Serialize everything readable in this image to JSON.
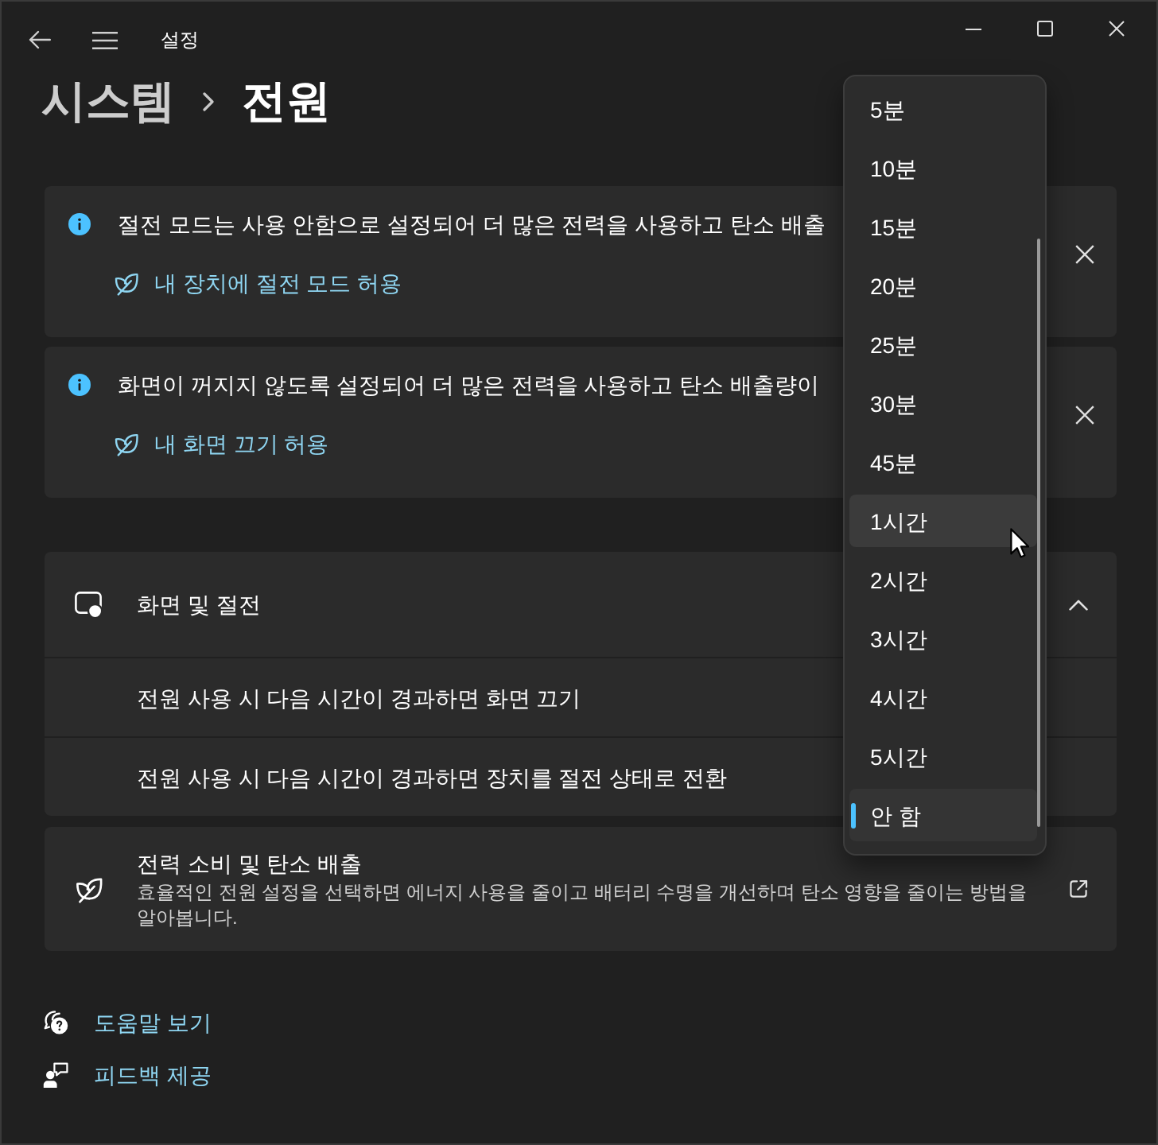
{
  "window": {
    "title": "설정"
  },
  "breadcrumb": [
    {
      "label": "시스템",
      "current": false
    },
    {
      "label": "전원",
      "current": true
    }
  ],
  "notices": [
    {
      "message": "절전 모드는 사용 안함으로 설정되어 더 많은 전력을 사용하고 탄소 배출",
      "link": "내 장치에 절전 모드 허용"
    },
    {
      "message": "화면이 꺼지지 않도록 설정되어 더 많은 전력을 사용하고 탄소 배출량이",
      "link": "내 화면 끄기 허용"
    }
  ],
  "screen_and_sleep": {
    "title": "화면 및 절전",
    "expanded": true,
    "rows": [
      {
        "label": "전원 사용 시 다음 시간이 경과하면 화면 끄기"
      },
      {
        "label": "전원 사용 시 다음 시간이 경과하면 장치를 절전 상태로 전환"
      }
    ]
  },
  "power_card": {
    "title": "전력 소비 및 탄소 배출",
    "description": "효율적인 전원 설정을 선택하면 에너지 사용을 줄이고 배터리 수명을 개선하며 탄소 영향을 줄이는 방법을 알아봅니다."
  },
  "footer_links": [
    {
      "kind": "help",
      "label": "도움말 보기"
    },
    {
      "kind": "feedback",
      "label": "피드백 제공"
    }
  ],
  "dropdown": {
    "options": [
      {
        "label": "5분",
        "selected": false,
        "hovered": false
      },
      {
        "label": "10분",
        "selected": false,
        "hovered": false
      },
      {
        "label": "15분",
        "selected": false,
        "hovered": false
      },
      {
        "label": "20분",
        "selected": false,
        "hovered": false
      },
      {
        "label": "25분",
        "selected": false,
        "hovered": false
      },
      {
        "label": "30분",
        "selected": false,
        "hovered": false
      },
      {
        "label": "45분",
        "selected": false,
        "hovered": false
      },
      {
        "label": "1시간",
        "selected": false,
        "hovered": true
      },
      {
        "label": "2시간",
        "selected": false,
        "hovered": false
      },
      {
        "label": "3시간",
        "selected": false,
        "hovered": false
      },
      {
        "label": "4시간",
        "selected": false,
        "hovered": false
      },
      {
        "label": "5시간",
        "selected": false,
        "hovered": false
      },
      {
        "label": "안 함",
        "selected": true,
        "hovered": false
      }
    ]
  }
}
